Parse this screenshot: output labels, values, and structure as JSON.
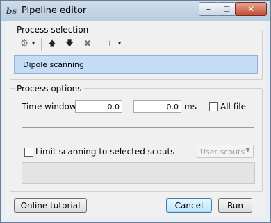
{
  "window": {
    "title": "Pipeline editor",
    "app_icon_text": "bs"
  },
  "title_buttons": {
    "minimize": "–",
    "maximize": "☐",
    "close": "✕"
  },
  "process_selection": {
    "title": "Process selection",
    "toolbar": {
      "gear": "⚙",
      "dropdown": "▾",
      "move_up": "🡅",
      "move_down": "🡇",
      "delete": "✖",
      "tree": "⊥"
    },
    "processes": [
      "Dipole scanning"
    ]
  },
  "process_options": {
    "title": "Process options",
    "time_window_label": "Time window:",
    "time_start": "0.0",
    "dash": "-",
    "time_end": "0.0",
    "unit": "ms",
    "all_file_label": "All file",
    "limit_label": "Limit scanning to selected scouts",
    "scouts_select": "User scouts"
  },
  "buttons": {
    "online_tutorial": "Online tutorial",
    "cancel": "Cancel",
    "run": "Run"
  }
}
